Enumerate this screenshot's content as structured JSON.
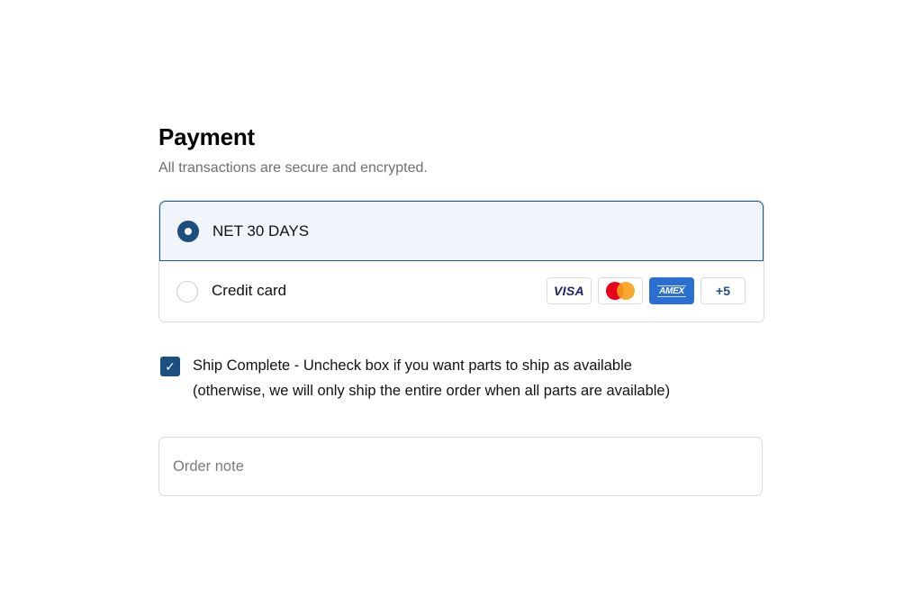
{
  "payment": {
    "title": "Payment",
    "subtitle": "All transactions are secure and encrypted.",
    "options": [
      {
        "label": "NET 30 DAYS",
        "selected": true
      },
      {
        "label": "Credit card",
        "selected": false
      }
    ],
    "card_badges": {
      "visa": "VISA",
      "amex": "AMEX",
      "more": "+5",
      "mastercard_icon": "mastercard-icon"
    }
  },
  "ship_complete": {
    "checked": true,
    "line1": "Ship Complete - Uncheck box if you want parts to ship as available",
    "line2": "(otherwise, we will only ship the entire order when all parts are available)"
  },
  "order_note": {
    "placeholder": "Order note",
    "value": ""
  },
  "colors": {
    "accent": "#1b4f7f",
    "selected_bg": "#f0f5fc",
    "border": "#dcdcdc",
    "muted_text": "#6f6f6f"
  }
}
